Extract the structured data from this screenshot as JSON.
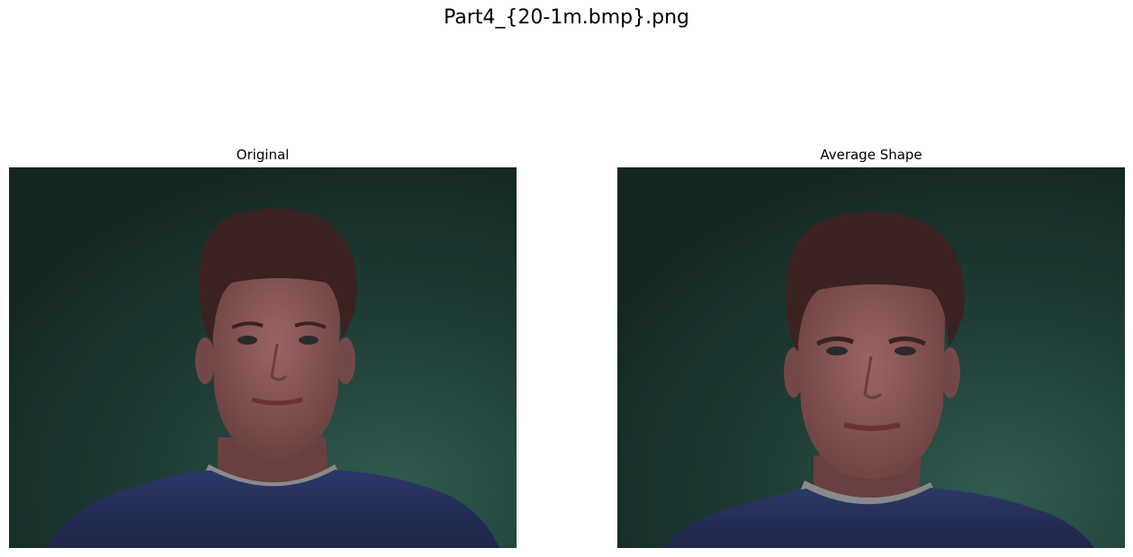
{
  "figure": {
    "title": "Part4_{20-1m.bmp}.png"
  },
  "panels": [
    {
      "title": "Original"
    },
    {
      "title": "Average Shape"
    }
  ],
  "colors": {
    "background_wall": "#1f3a33",
    "hair": "#3a2220",
    "skin": "#8a5656",
    "shirt": "#26305a"
  }
}
